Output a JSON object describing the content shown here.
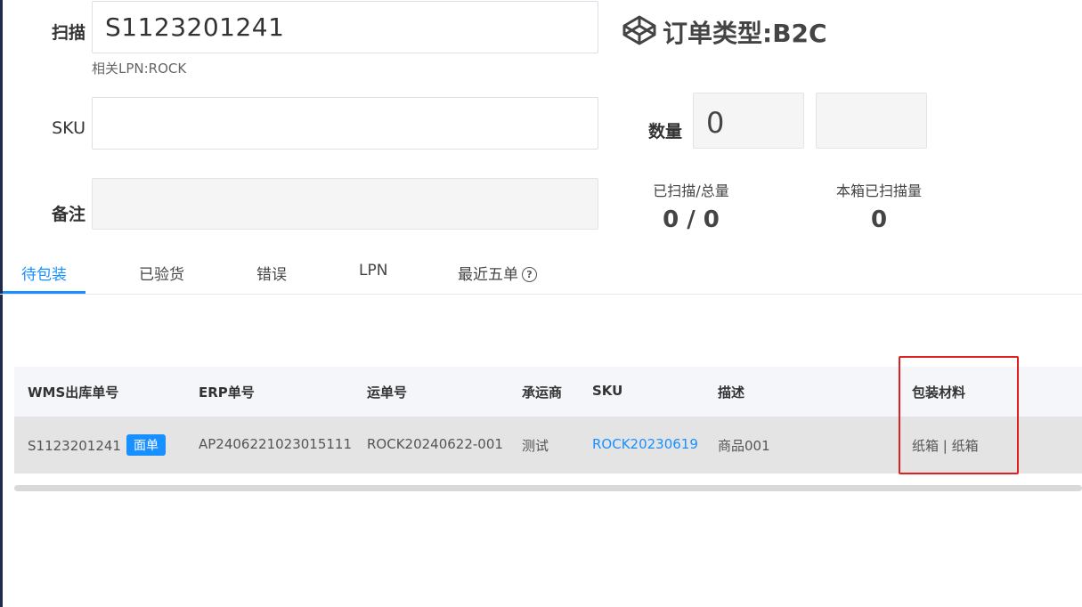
{
  "form": {
    "scan_label": "扫描",
    "scan_value": "S1123201241",
    "related_lpn": "相关LPN:ROCK",
    "sku_label": "SKU",
    "sku_value": "",
    "remark_label": "备注",
    "remark_value": ""
  },
  "order_type": {
    "text": "订单类型:B2C",
    "icon": "codepen-cube-icon"
  },
  "quantity": {
    "label": "数量",
    "value": "0",
    "extra": ""
  },
  "stats": {
    "scanned_total_label": "已扫描/总量",
    "scanned_total_value": "0 / 0",
    "box_scanned_label": "本箱已扫描量",
    "box_scanned_value": "0"
  },
  "tabs": [
    {
      "label": "待包装",
      "active": true
    },
    {
      "label": "已验货",
      "active": false
    },
    {
      "label": "错误",
      "active": false
    },
    {
      "label": "LPN",
      "active": false
    },
    {
      "label": "最近五单",
      "active": false,
      "help_icon": "question-circle-icon",
      "help_glyph": "?"
    }
  ],
  "table": {
    "headers": [
      "WMS出库单号",
      "ERP单号",
      "运单号",
      "承运商",
      "SKU",
      "描述",
      "包装材料"
    ],
    "rows": [
      {
        "wms_no": "S1123201241",
        "badge": "面单",
        "erp_no": "AP2406221023015111",
        "waybill": "ROCK20240622-001",
        "carrier": "测试",
        "sku": "ROCK20230619",
        "desc": "商品001",
        "packaging": "纸箱 | 纸箱"
      }
    ]
  },
  "colors": {
    "accent": "#1890ff",
    "highlight_box": "#e02020",
    "sidebar_edge": "#1d2c4c"
  }
}
